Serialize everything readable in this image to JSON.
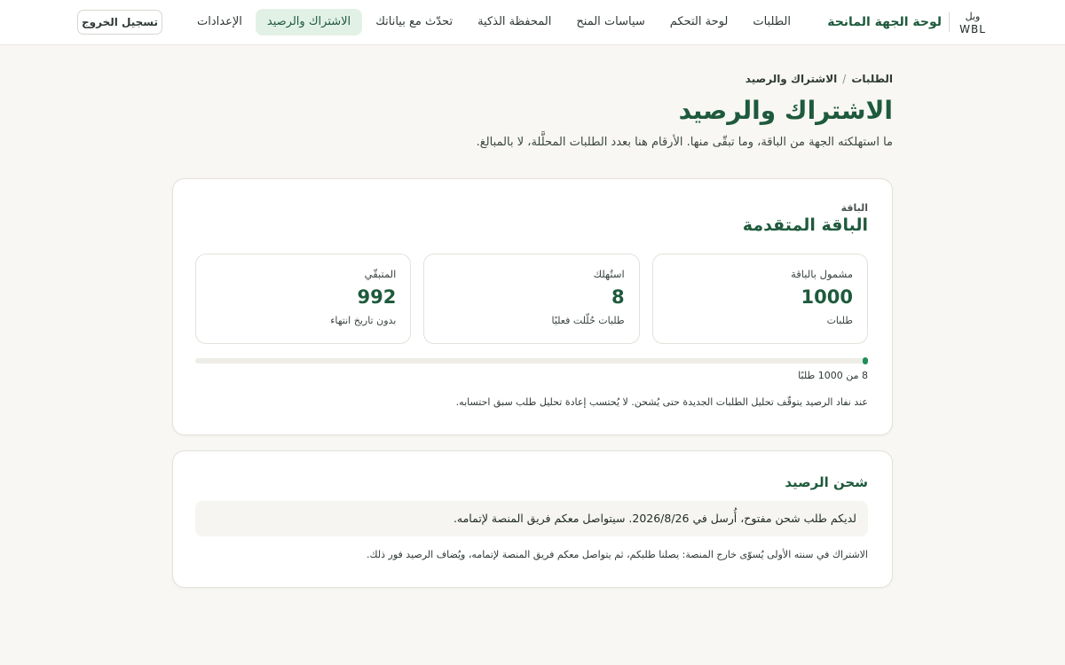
{
  "brand": {
    "logo_text_top": "وبل",
    "logo_text_bottom": "WBL",
    "title": "لوحة الجهة المانحة"
  },
  "nav": {
    "items": [
      {
        "label": "الطلبات",
        "active": false
      },
      {
        "label": "لوحة التحكم",
        "active": false
      },
      {
        "label": "سياسات المنح",
        "active": false
      },
      {
        "label": "المحفظة الذكية",
        "active": false
      },
      {
        "label": "تحدّث مع بياناتك",
        "active": false
      },
      {
        "label": "الاشتراك والرصيد",
        "active": true
      },
      {
        "label": "الإعدادات",
        "active": false
      }
    ],
    "logout_label": "تسجيل الخروج"
  },
  "breadcrumb": {
    "parent": "الطلبات",
    "separator": "/",
    "current": "الاشتراك والرصيد"
  },
  "page": {
    "title": "الاشتراك والرصيد",
    "subtitle": "ما استهلكته الجهة من الباقة، وما تبقّى منها. الأرقام هنا بعدد الطلبات المحلَّلة، لا بالمبالغ."
  },
  "plan": {
    "label": "الباقة",
    "name": "الباقة المتقدمة",
    "stats": [
      {
        "label": "مشمول بالباقة",
        "value": "1000",
        "note": "طلبات"
      },
      {
        "label": "استُهلك",
        "value": "8",
        "note": "طلبات حُلّلت فعليًا"
      },
      {
        "label": "المتبقّي",
        "value": "992",
        "note": "بدون تاريخ انتهاء"
      }
    ],
    "usage": {
      "used": 8,
      "total": 1000,
      "fraction": 0.008
    },
    "progress_text": "8 من 1000 طلبًا",
    "note": "عند نفاد الرصيد يتوقّف تحليل الطلبات الجديدة حتى يُشحن. لا يُحتسب إعادة تحليل طلب سبق احتسابه."
  },
  "recharge": {
    "title": "شحن الرصيد",
    "notice": "لديكم طلب شحن مفتوح، أُرسل في 2026/8/26. سيتواصل معكم فريق المنصة لإتمامه.",
    "note": "الاشتراك في سنته الأولى يُسوّى خارج المنصة: يصلنا طلبكم، ثم يتواصل معكم فريق المنصة لإتمامه، ويُضاف الرصيد فور ذلك."
  },
  "colors": {
    "accent": "#1e5a3c",
    "progress": "#1f8f5a",
    "active_nav_bg": "#e2f1e6",
    "page_bg": "#f8f7f3"
  }
}
